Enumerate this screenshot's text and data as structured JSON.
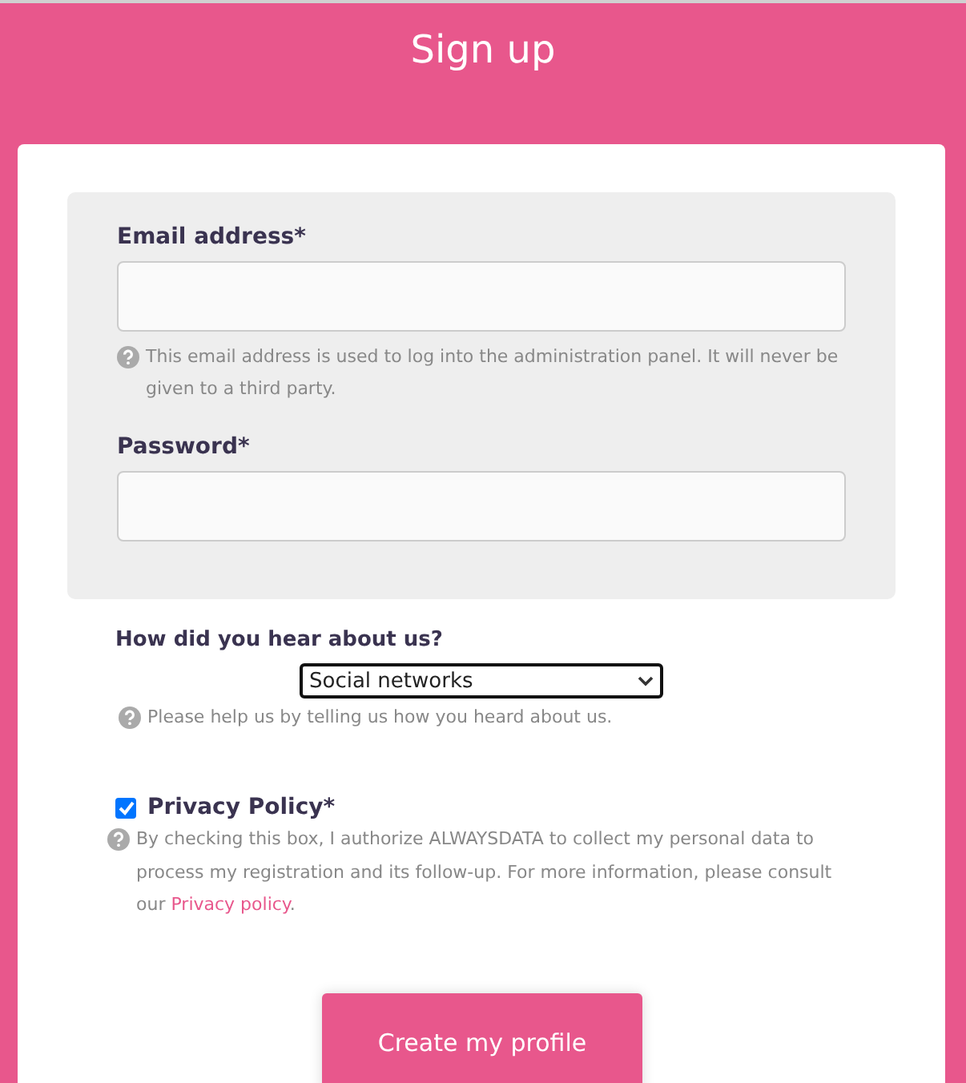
{
  "header": {
    "title": "Sign up"
  },
  "fields": [
    {
      "label": "Email address*",
      "help": "This email address is used to log into the administration panel. It will never be given to a third party."
    },
    {
      "label": "Password*"
    }
  ],
  "referral": {
    "label": "How did you hear about us?",
    "value": "Social networks",
    "help": "Please help us by telling us how you heard about us."
  },
  "privacy": {
    "label": "Privacy Policy*",
    "checked": true,
    "text_before": "By checking this box, I authorize ALWAYSDATA to collect my personal data to process my registration and its follow-up. For more information, please consult our ",
    "link": "Privacy policy",
    "text_after": "."
  },
  "submit": {
    "label": "Create my profile"
  }
}
